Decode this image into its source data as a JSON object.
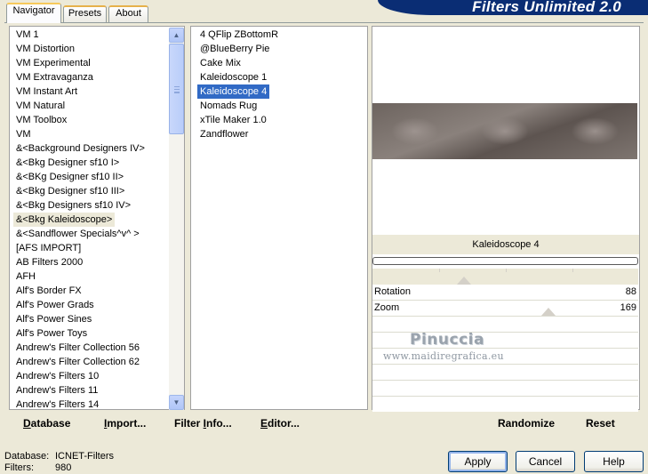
{
  "window": {
    "title": "Filters Unlimited 2.0"
  },
  "tabs": [
    {
      "label": "Navigator",
      "active": true
    },
    {
      "label": "Presets",
      "active": false
    },
    {
      "label": "About",
      "active": false
    }
  ],
  "categories": {
    "items": [
      "VM 1",
      "VM Distortion",
      "VM Experimental",
      "VM Extravaganza",
      "VM Instant Art",
      "VM Natural",
      "VM Toolbox",
      "VM",
      "&<Background Designers IV>",
      "&<Bkg Designer sf10 I>",
      "&<BKg Designer sf10 II>",
      "&<Bkg Designer sf10 III>",
      "&<Bkg Designers sf10 IV>",
      "&<Bkg Kaleidoscope>",
      "&<Sandflower Specials^v^ >",
      "[AFS IMPORT]",
      "AB Filters 2000",
      "AFH",
      "Alf's Border FX",
      "Alf's Power Grads",
      "Alf's Power Sines",
      "Alf's Power Toys",
      "Andrew's Filter Collection 56",
      "Andrew's Filter Collection 62",
      "Andrew's Filters 10",
      "Andrew's Filters 11",
      "Andrew's Filters 14"
    ],
    "selected_index": 13
  },
  "filters": {
    "items": [
      "4 QFlip ZBottomR",
      "@BlueBerry Pie",
      "Cake Mix",
      "Kaleidoscope 1",
      "Kaleidoscope 4",
      "Nomads Rug",
      "xTile Maker 1.0",
      "Zandflower"
    ],
    "selected_index": 4
  },
  "preview": {
    "filter_name": "Kaleidoscope 4",
    "progress": 0
  },
  "params": [
    {
      "label": "Rotation",
      "value": "88",
      "fraction": 0.345
    },
    {
      "label": "Zoom",
      "value": "169",
      "fraction": 0.663
    }
  ],
  "watermark": {
    "name": "Pinuccia",
    "url": "www.maidiregrafica.eu"
  },
  "toolbar": {
    "database": {
      "prefix": "",
      "underline": "D",
      "rest": "atabase"
    },
    "import": {
      "prefix": "",
      "underline": "I",
      "rest": "mport..."
    },
    "filter_info": {
      "prefix": "Filter ",
      "underline": "I",
      "rest": "nfo..."
    },
    "editor": {
      "prefix": "",
      "underline": "E",
      "rest": "ditor..."
    },
    "randomize": "Randomize",
    "reset": "Reset"
  },
  "status": {
    "database_label": "Database:",
    "database_value": "ICNET-Filters",
    "filters_label": "Filters:",
    "filters_value": "980"
  },
  "buttons": {
    "apply": "Apply",
    "cancel": "Cancel",
    "help": "Help"
  },
  "icons": {
    "scroll_up": "chevron-up-icon",
    "scroll_down": "chevron-down-icon"
  }
}
